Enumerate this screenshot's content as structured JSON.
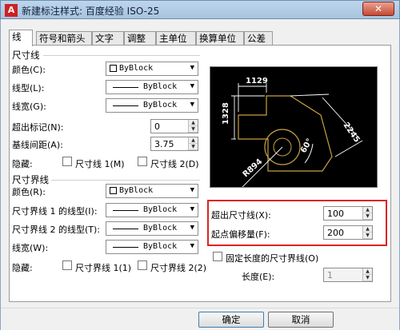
{
  "window": {
    "title": "新建标注样式: 百度经验 ISO-25",
    "close": "✕"
  },
  "tabs": [
    "线",
    "符号和箭头",
    "文字",
    "调整",
    "主单位",
    "换算单位",
    "公差"
  ],
  "dimension_lines": {
    "group_title": "尺寸线",
    "color_label": "颜色(C):",
    "color_value": "ByBlock",
    "linetype_label": "线型(L):",
    "linetype_value": "ByBlock",
    "lineweight_label": "线宽(G):",
    "lineweight_value": "ByBlock",
    "extend_beyond_ticks_label": "超出标记(N):",
    "extend_beyond_ticks_value": "0",
    "baseline_spacing_label": "基线间距(A):",
    "baseline_spacing_value": "3.75",
    "suppress_label": "隐藏:",
    "suppress_1": "尺寸线 1(M)",
    "suppress_2": "尺寸线 2(D)"
  },
  "extension_lines": {
    "group_title": "尺寸界线",
    "color_label": "颜色(R):",
    "color_value": "ByBlock",
    "linetype1_label": "尺寸界线 1 的线型(I):",
    "linetype1_value": "ByBlock",
    "linetype2_label": "尺寸界线 2 的线型(T):",
    "linetype2_value": "ByBlock",
    "lineweight_label": "线宽(W):",
    "lineweight_value": "ByBlock",
    "suppress_label": "隐藏:",
    "suppress_1": "尺寸界线 1(1)",
    "suppress_2": "尺寸界线 2(2)"
  },
  "right_panel": {
    "extend_beyond_dim_label": "超出尺寸线(X):",
    "extend_beyond_dim_value": "100",
    "offset_from_origin_label": "起点偏移量(F):",
    "offset_from_origin_value": "200",
    "fixed_length_label": "固定长度的尺寸界线(O)",
    "length_label": "长度(E):",
    "length_value": "1"
  },
  "preview": {
    "dim_top": "1129",
    "dim_left": "1328",
    "dim_right": "2245",
    "dim_angle": "60°",
    "dim_radius": "R894"
  },
  "buttons": {
    "ok": "确定",
    "cancel": "取消"
  },
  "colors": {
    "highlight": "#dd2222",
    "preview_bg": "#000000",
    "preview_lines": "#ffffff",
    "preview_geometry": "#c8a040"
  }
}
